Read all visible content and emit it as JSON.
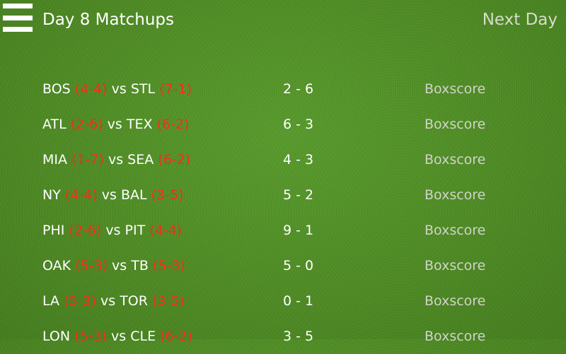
{
  "header": {
    "menu_icon": "hamburger-menu-icon",
    "title": "Day 8 Matchups",
    "next_label": "Next Day"
  },
  "colors": {
    "background": "#4d8a22",
    "record": "#ff2a1a",
    "link": "#cfd4c8",
    "text": "#ffffff"
  },
  "matchups": [
    {
      "team1": "BOS",
      "rec1": "(4-4)",
      "vs": "vs",
      "team2": "STL",
      "rec2": "(7-1)",
      "score": "2 - 6",
      "link": "Boxscore"
    },
    {
      "team1": "ATL",
      "rec1": "(2-6)",
      "vs": "vs",
      "team2": "TEX",
      "rec2": "(6-2)",
      "score": "6 - 3",
      "link": "Boxscore"
    },
    {
      "team1": "MIA",
      "rec1": "(1-7)",
      "vs": "vs",
      "team2": "SEA",
      "rec2": "(6-2)",
      "score": "4 - 3",
      "link": "Boxscore"
    },
    {
      "team1": "NY",
      "rec1": "(4-4)",
      "vs": "vs",
      "team2": "BAL",
      "rec2": "(3-5)",
      "score": "5 - 2",
      "link": "Boxscore"
    },
    {
      "team1": "PHI",
      "rec1": "(2-6)",
      "vs": "vs",
      "team2": "PIT",
      "rec2": "(4-4)",
      "score": "9 - 1",
      "link": "Boxscore"
    },
    {
      "team1": "OAK",
      "rec1": "(5-3)",
      "vs": "vs",
      "team2": "TB",
      "rec2": "(5-3)",
      "score": "5 - 0",
      "link": "Boxscore"
    },
    {
      "team1": "LA",
      "rec1": "(5-3)",
      "vs": "vs",
      "team2": "TOR",
      "rec2": "(3-5)",
      "score": "0 - 1",
      "link": "Boxscore"
    },
    {
      "team1": "LON",
      "rec1": "(5-3)",
      "vs": "vs",
      "team2": "CLE",
      "rec2": "(6-2)",
      "score": "3 - 5",
      "link": "Boxscore"
    }
  ]
}
